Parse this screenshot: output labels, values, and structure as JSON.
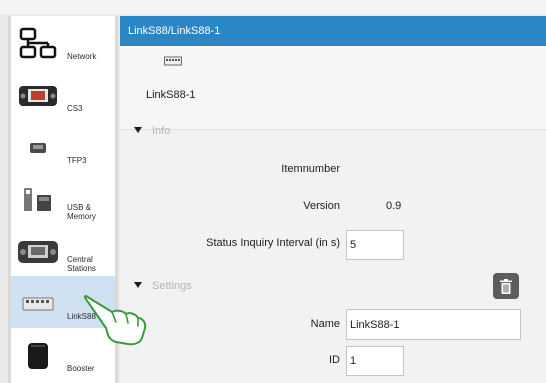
{
  "sidebar": {
    "items": [
      {
        "label": "Network",
        "icon": "network-icon"
      },
      {
        "label": "CS3",
        "icon": "cs3-device-icon"
      },
      {
        "label": "TFP3",
        "icon": "tfp3-device-icon"
      },
      {
        "label": "USB & Memory",
        "icon": "usb-memory-icon"
      },
      {
        "label": "Central Stations",
        "icon": "central-stations-icon"
      },
      {
        "label": "LinkS88",
        "icon": "links88-icon",
        "active": true
      },
      {
        "label": "Booster",
        "icon": "booster-icon"
      }
    ]
  },
  "header": {
    "title": "LinkS88/LinkS88-1"
  },
  "device": {
    "name": "LinkS88-1",
    "icon": "links88-module-icon"
  },
  "info": {
    "section_label": "Info",
    "itemnumber_label": "Itemnumber",
    "version_label": "Version",
    "version_value": "0.9",
    "status_interval_label": "Status Inquiry Interval (in s)",
    "status_interval_value": "5"
  },
  "settings": {
    "section_label": "Settings",
    "name_label": "Name",
    "name_value": "LinkS88-1",
    "id_label": "ID",
    "id_value": "1",
    "delete_icon": "trash-icon"
  },
  "colors": {
    "titlebar": "#2b86c5",
    "active_sidebar": "#cfe1f1",
    "hand_outline": "#3b9a3b"
  }
}
